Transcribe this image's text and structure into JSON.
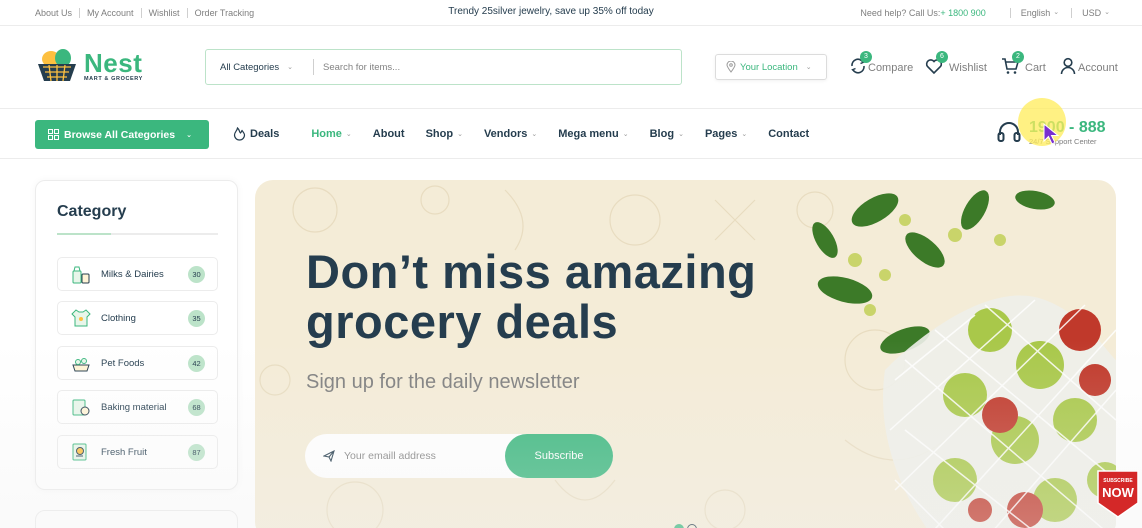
{
  "topbar": {
    "links": [
      "About Us",
      "My Account",
      "Wishlist",
      "Order Tracking"
    ],
    "promo": "Trendy 25silver jewelry, save up 35% off today",
    "help_label": "Need help? Call Us:",
    "help_phone": "+ 1800 900",
    "language": "English",
    "currency": "USD"
  },
  "brand": {
    "name": "Nest",
    "tagline": "MART & GROCERY",
    "accent": "#3bb77e",
    "dark": "#253d4e"
  },
  "search": {
    "category": "All Categories",
    "placeholder": "Search for items..."
  },
  "location": {
    "placeholder": "Your Location"
  },
  "header_actions": [
    {
      "label": "Compare",
      "badge": "3",
      "icon": "compare-icon"
    },
    {
      "label": "Wishlist",
      "badge": "6",
      "icon": "heart-icon"
    },
    {
      "label": "Cart",
      "badge": "2",
      "icon": "cart-icon"
    },
    {
      "label": "Account",
      "icon": "user-icon"
    }
  ],
  "nav": {
    "browse_label": "Browse All Categories",
    "deals_label": "Deals",
    "items": [
      {
        "label": "Home",
        "dropdown": true,
        "active": true
      },
      {
        "label": "About",
        "dropdown": false
      },
      {
        "label": "Shop",
        "dropdown": true
      },
      {
        "label": "Vendors",
        "dropdown": true
      },
      {
        "label": "Mega menu",
        "dropdown": true
      },
      {
        "label": "Blog",
        "dropdown": true
      },
      {
        "label": "Pages",
        "dropdown": true
      },
      {
        "label": "Contact",
        "dropdown": false
      }
    ],
    "support_number": "1900 - 888",
    "support_label": "24/7 Support Center"
  },
  "sidebar": {
    "title": "Category",
    "items": [
      {
        "label": "Milks & Dairies",
        "count": "30",
        "icon": "milk-icon"
      },
      {
        "label": "Clothing",
        "count": "35",
        "icon": "clothing-icon"
      },
      {
        "label": "Pet Foods",
        "count": "42",
        "icon": "pet-food-icon"
      },
      {
        "label": "Baking material",
        "count": "68",
        "icon": "baking-icon"
      },
      {
        "label": "Fresh Fruit",
        "count": "87",
        "icon": "fruit-icon"
      }
    ]
  },
  "hero": {
    "headline_line1": "Don’t miss amazing",
    "headline_line2": "grocery deals",
    "subtitle": "Sign up for the daily newsletter",
    "email_placeholder": "Your emaill address",
    "subscribe_label": "Subscribe",
    "slides_total": 2,
    "slide_active": 1
  },
  "overlay": {
    "subscribe_badge_top": "SUBSCRIBE",
    "subscribe_badge_main": "NOW"
  }
}
